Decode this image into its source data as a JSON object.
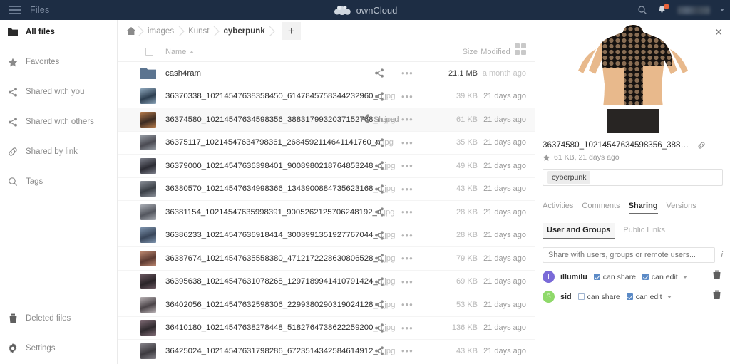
{
  "topbar": {
    "menu_icon": "hamburger-menu-icon",
    "app_title": "Files",
    "logo_text": "ownCloud",
    "search_icon": "search-icon",
    "notifications_icon": "bell-icon",
    "user_menu_caret": "chevron-down-icon"
  },
  "sidebar": {
    "items": [
      {
        "label": "All files",
        "icon": "folder-icon",
        "active": true
      },
      {
        "label": "Favorites",
        "icon": "star-icon",
        "active": false
      },
      {
        "label": "Shared with you",
        "icon": "share-icon",
        "active": false
      },
      {
        "label": "Shared with others",
        "icon": "share-icon",
        "active": false
      },
      {
        "label": "Shared by link",
        "icon": "link-icon",
        "active": false
      },
      {
        "label": "Tags",
        "icon": "magnifier-icon",
        "active": false
      }
    ],
    "bottom_items": [
      {
        "label": "Deleted files",
        "icon": "trash-icon"
      },
      {
        "label": "Settings",
        "icon": "gear-icon"
      }
    ]
  },
  "breadcrumb": {
    "home_icon": "home-icon",
    "crumbs": [
      "images",
      "Kunst",
      "cyberpunk"
    ],
    "new_button_label": "+",
    "grid_toggle_icon": "grid-view-icon"
  },
  "filelist": {
    "columns": {
      "name": "Name",
      "size": "Size",
      "modified": "Modified"
    },
    "sort_indicator": "ascending",
    "shared_label": "Shared",
    "more_label": "•••",
    "rows": [
      {
        "name": "cash4ram",
        "ext": "",
        "type": "folder",
        "size": "21.1 MB",
        "modified": "a month ago",
        "shared": false,
        "selected": false
      },
      {
        "name": "36370338_10214547638358450_6147845758344232960_n",
        "ext": ".jpg",
        "type": "file",
        "size": "39 KB",
        "modified": "21 days ago",
        "shared": false,
        "selected": false
      },
      {
        "name": "36374580_10214547634598356_3883179932037152768_n",
        "ext": ".jpg",
        "type": "file",
        "size": "61 KB",
        "modified": "21 days ago",
        "shared": true,
        "selected": true
      },
      {
        "name": "36375117_10214547634798361_2684592114641141760_n",
        "ext": ".jpg",
        "type": "file",
        "size": "35 KB",
        "modified": "21 days ago",
        "shared": false,
        "selected": false
      },
      {
        "name": "36379000_10214547636398401_9008980218764853248_n",
        "ext": ".jpg",
        "type": "file",
        "size": "49 KB",
        "modified": "21 days ago",
        "shared": false,
        "selected": false
      },
      {
        "name": "36380570_10214547634998366_1343900884735623168_n",
        "ext": ".jpg",
        "type": "file",
        "size": "43 KB",
        "modified": "21 days ago",
        "shared": false,
        "selected": false
      },
      {
        "name": "36381154_10214547635998391_9005262125706248192_n",
        "ext": ".jpg",
        "type": "file",
        "size": "28 KB",
        "modified": "21 days ago",
        "shared": false,
        "selected": false
      },
      {
        "name": "36386233_10214547636918414_3003991351927767044_n",
        "ext": ".jpg",
        "type": "file",
        "size": "28 KB",
        "modified": "21 days ago",
        "shared": false,
        "selected": false
      },
      {
        "name": "36387674_10214547635558380_4712172228630806528_n",
        "ext": ".jpg",
        "type": "file",
        "size": "79 KB",
        "modified": "21 days ago",
        "shared": false,
        "selected": false
      },
      {
        "name": "36395638_10214547631078268_1297189941410791424_n",
        "ext": ".jpg",
        "type": "file",
        "size": "69 KB",
        "modified": "21 days ago",
        "shared": false,
        "selected": false
      },
      {
        "name": "36402056_10214547632598306_2299380290319024128_n",
        "ext": ".jpg",
        "type": "file",
        "size": "53 KB",
        "modified": "21 days ago",
        "shared": false,
        "selected": false
      },
      {
        "name": "36410180_10214547638278448_5182764738622259200_n",
        "ext": ".jpg",
        "type": "file",
        "size": "136 KB",
        "modified": "21 days ago",
        "shared": false,
        "selected": false
      },
      {
        "name": "36425024_10214547631798286_6723514342584614912_n",
        "ext": ".jpg",
        "type": "file",
        "size": "43 KB",
        "modified": "21 days ago",
        "shared": false,
        "selected": false
      }
    ]
  },
  "details": {
    "close_icon": "close-icon",
    "preview_alt": "file-preview-image",
    "filename": "36374580_10214547634598356_38831799...",
    "link_icon": "link-icon",
    "favorite_icon": "star-icon",
    "meta": "61 KB, 21 days ago",
    "tag": "cyberpunk",
    "tabs": [
      {
        "label": "Activities",
        "active": false
      },
      {
        "label": "Comments",
        "active": false
      },
      {
        "label": "Sharing",
        "active": true
      },
      {
        "label": "Versions",
        "active": false
      }
    ],
    "subtabs": [
      {
        "label": "User and Groups",
        "active": true
      },
      {
        "label": "Public Links",
        "active": false
      }
    ],
    "share_placeholder": "Share with users, groups or remote users...",
    "share_input_value": "",
    "info_icon": "info-icon",
    "can_share_label": "can share",
    "can_edit_label": "can edit",
    "shares": [
      {
        "name": "illumilu",
        "initial": "I",
        "color": "#7a6ad8",
        "can_share": true,
        "can_edit": true
      },
      {
        "name": "sid",
        "initial": "S",
        "color": "#8fd96a",
        "can_share": false,
        "can_edit": true
      }
    ],
    "delete_icon": "trash-icon",
    "dropdown_icon": "chevron-down-icon"
  }
}
